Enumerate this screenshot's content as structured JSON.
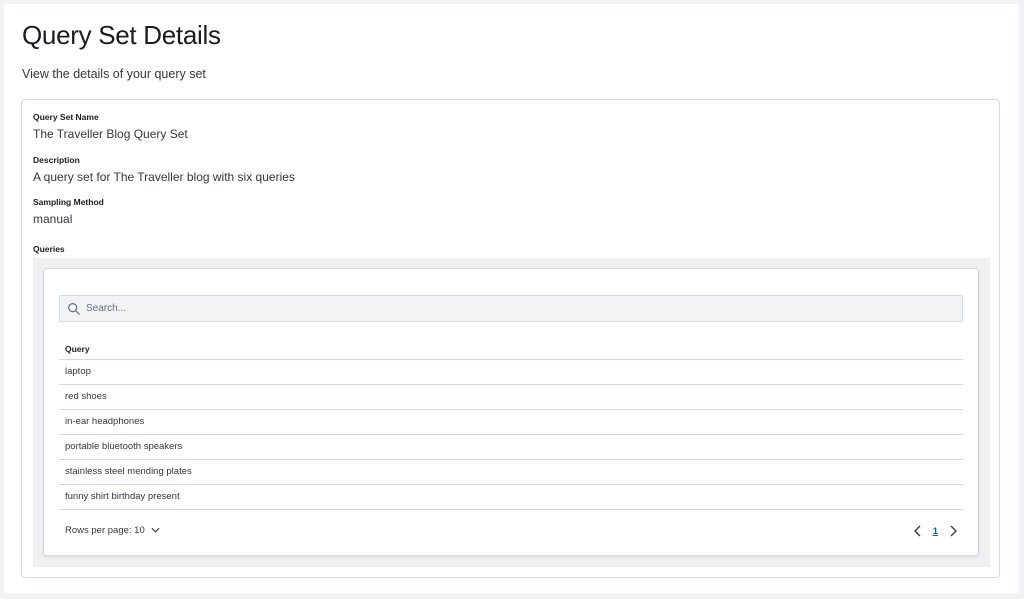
{
  "header": {
    "title": "Query Set Details",
    "subtitle": "View the details of your query set"
  },
  "details": {
    "name_label": "Query Set Name",
    "name_value": "The Traveller Blog Query Set",
    "description_label": "Description",
    "description_value": "A query set for The Traveller blog with six queries",
    "sampling_label": "Sampling Method",
    "sampling_value": "manual",
    "queries_label": "Queries"
  },
  "queries_table": {
    "search": {
      "placeholder": "Search...",
      "value": "",
      "icon": "search-icon"
    },
    "column_header": "Query",
    "rows": [
      "laptop",
      "red shoes",
      "in-ear headphones",
      "portable bluetooth speakers",
      "stainless steel mending plates",
      "funny shirt birthday present"
    ],
    "rows_per_page_label": "Rows per page: 10",
    "pagination": {
      "current_page": "1"
    }
  },
  "colors": {
    "border": "#d3dae6",
    "link": "#006bb4",
    "outer_background": "#f1f2f3"
  }
}
